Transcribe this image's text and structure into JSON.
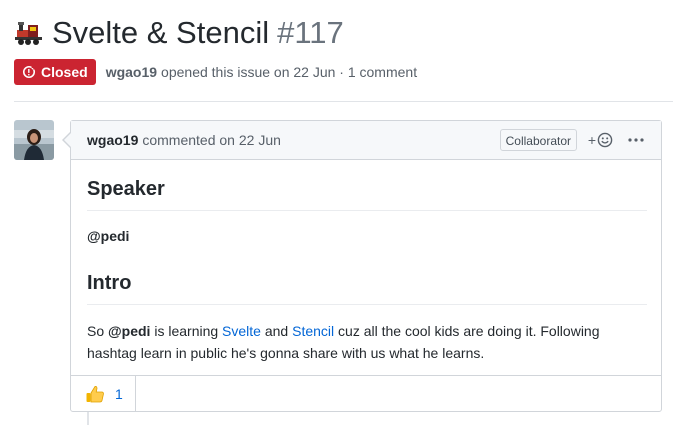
{
  "issue": {
    "icon": "steam-locomotive-icon",
    "title": "Svelte & Stencil",
    "number": "#117",
    "status": "Closed",
    "status_color": "#cb2431",
    "author": "wgao19",
    "opened_text": "opened this issue on 22 Jun · 1 comment"
  },
  "comment": {
    "author": "wgao19",
    "meta": "commented on 22 Jun",
    "role_badge": "Collaborator",
    "reaction_add_label": "+",
    "speaker_heading": "Speaker",
    "speaker_handle": "@pedi",
    "intro_heading": "Intro",
    "intro": {
      "t1": "So ",
      "mention": "@pedi",
      "t2": " is learning ",
      "link1": "Svelte",
      "t3": " and ",
      "link2": "Stencil",
      "t4": " cuz all the cool kids are doing it. Following hashtag learn in public he's gonna share with us what he learns."
    },
    "reactions": [
      {
        "icon": "thumbs-up-icon",
        "count": "1"
      }
    ],
    "link_color": "#0366d6"
  }
}
